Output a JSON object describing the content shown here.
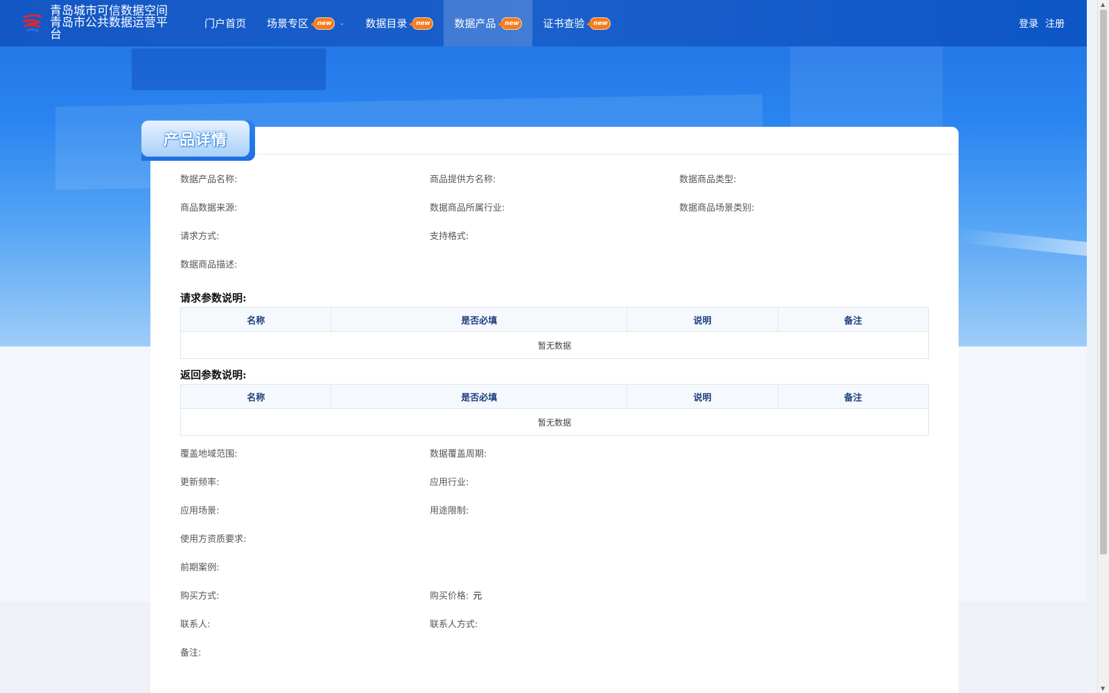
{
  "brand": {
    "line1": "青岛城市可信数据空间",
    "line2": "青岛市公共数据运营平台"
  },
  "nav": {
    "items": [
      {
        "label": "门户首页",
        "badge": ""
      },
      {
        "label": "场景专区",
        "badge": "new"
      },
      {
        "label": "数据目录",
        "badge": "new"
      },
      {
        "label": "数据产品",
        "badge": "new"
      },
      {
        "label": "证书查验",
        "badge": "new"
      }
    ],
    "login": "登录",
    "register": "注册"
  },
  "page_title": "产品详情",
  "fields": {
    "product_name": "数据产品名称:",
    "provider_name": "商品提供方名称:",
    "product_type": "数据商品类型:",
    "data_source": "商品数据来源:",
    "industry": "数据商品所属行业:",
    "scene_category": "数据商品场景类别:",
    "request_method": "请求方式:",
    "formats": "支持格式:",
    "description": "数据商品描述:",
    "coverage_region": "覆盖地域范围:",
    "coverage_period": "数据覆盖周期:",
    "update_frequency": "更新频率:",
    "app_industry": "应用行业:",
    "app_scene": "应用场景:",
    "usage_limit": "用途限制:",
    "qualification": "使用方资质要求:",
    "cases": "前期案例:",
    "purchase_method": "购买方式:",
    "price_label": "购买价格:",
    "price_unit": "元",
    "contact": "联系人:",
    "contact_method": "联系人方式:",
    "remark": "备注:"
  },
  "request_params": {
    "title": "请求参数说明:",
    "headers": [
      "名称",
      "是否必填",
      "说明",
      "备注"
    ],
    "empty": "暂无数据"
  },
  "response_params": {
    "title": "返回参数说明:",
    "headers": [
      "名称",
      "是否必填",
      "说明",
      "备注"
    ],
    "empty": "暂无数据"
  }
}
